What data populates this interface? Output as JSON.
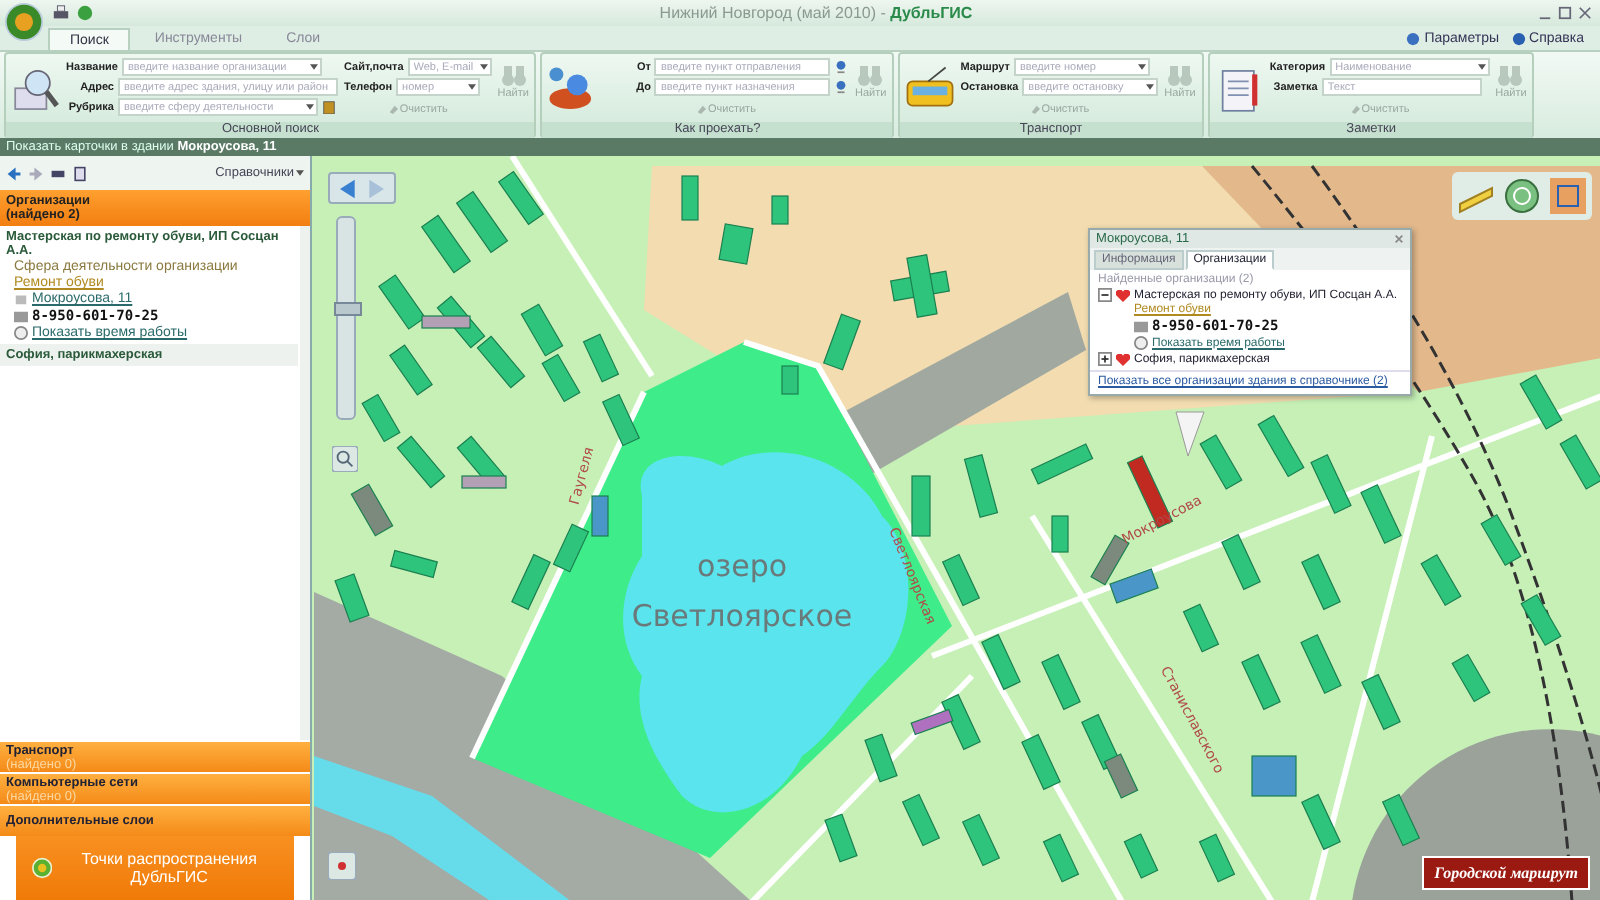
{
  "window": {
    "title": "Нижний Новгород (май 2010) - **ДубльГИС**"
  },
  "tabs": [
    {
      "label": "Поиск",
      "selected": true
    },
    {
      "label": "Инструменты",
      "selected": false
    },
    {
      "label": "Слои",
      "selected": false
    }
  ],
  "help_links": [
    "Параметры",
    "Справка"
  ],
  "ribbon": [
    {
      "title": "Основной поиск",
      "kind": "search",
      "columns": [
        [
          {
            "label": "Название",
            "placeholder": "введите название организации",
            "kind": "dropdown"
          },
          {
            "label": "Адрес",
            "placeholder": "введите адрес здания, улицу или район",
            "kind": "text"
          },
          {
            "label": "Рубрика",
            "placeholder": "введите сферу деятельности",
            "kind": "rubric"
          }
        ],
        [
          {
            "label": "Сайт,почта",
            "placeholder": "Web, E-mail",
            "kind": "dropdown"
          },
          {
            "label": "Телефон",
            "placeholder": "номер",
            "kind": "dropdown"
          }
        ]
      ],
      "clear": {
        "label": "Очистить",
        "disabled": true
      },
      "find": {
        "label": "Найти",
        "disabled": true
      }
    },
    {
      "title": "Как проехать?",
      "kind": "route",
      "columns": [
        [
          {
            "label": "От",
            "placeholder": "введите пункт отправления",
            "kind": "route"
          },
          {
            "label": "До",
            "placeholder": "введите пункт назначения",
            "kind": "route"
          }
        ]
      ],
      "clear": {
        "label": "Очистить",
        "disabled": true
      },
      "find": {
        "label": "Найти",
        "disabled": true
      }
    },
    {
      "title": "Транспорт",
      "kind": "bus",
      "columns": [
        [
          {
            "label": "Маршрут",
            "placeholder": "введите номер",
            "kind": "dropdown"
          },
          {
            "label": "Остановка",
            "placeholder": "введите остановку",
            "kind": "dropdown"
          }
        ]
      ],
      "clear": {
        "label": "Очистить",
        "disabled": true
      },
      "find": {
        "label": "Найти",
        "disabled": true
      }
    },
    {
      "title": "Заметки",
      "kind": "notes",
      "columns": [
        [
          {
            "label": "Категория",
            "placeholder": "Наименование",
            "kind": "dropdown"
          },
          {
            "label": "Заметка",
            "placeholder": "Текст",
            "kind": "text"
          }
        ]
      ],
      "clear": {
        "label": "Очистить",
        "disabled": true
      },
      "find": {
        "label": "Найти",
        "disabled": true
      }
    }
  ],
  "hint_bar": "Показать карточки в здании **Мокроусова, 11**",
  "left_panel": {
    "directories_button": "Справочники",
    "organizations": {
      "title": "Организации",
      "count": "(найдено 2)",
      "items": [
        {
          "name": "Мастерская по ремонту обуви, ИП Сосцан А.А.",
          "expanded": true,
          "category_caption": "Сфера деятельности организации",
          "category": "Ремонт обуви",
          "address": "Мокроусова, 11",
          "phone": "8-950-601-70-25",
          "hours_link": "Показать время работы"
        },
        {
          "name": "София, парикмахерская",
          "expanded": false
        }
      ]
    },
    "sections": [
      {
        "title": "Транспорт",
        "count": "(найдено 0)"
      },
      {
        "title": "Компьютерные сети",
        "count": "(найдено 0)"
      },
      {
        "title": "Дополнительные слои"
      }
    ],
    "promo_button": "Точки распространения ДубльГИС"
  },
  "map": {
    "labels": [
      {
        "text": "озеро",
        "kind": "lake"
      },
      {
        "text": "Светлоярское",
        "kind": "lake"
      },
      {
        "text": "Мокроусова",
        "kind": "street"
      },
      {
        "text": "Станиславского",
        "kind": "street"
      },
      {
        "text": "Светлоярская",
        "kind": "street"
      },
      {
        "text": "Гаугеля",
        "kind": "street"
      }
    ],
    "zoom": {
      "level": 0.55
    },
    "route_button": "Городской маршрут",
    "popup": {
      "title": "Мокроусова, 11",
      "tabs": [
        {
          "label": "Информация",
          "selected": false
        },
        {
          "label": "Организации",
          "selected": true
        }
      ],
      "found_caption": "Найденные организации (2)",
      "items": [
        {
          "name": "Мастерская по ремонту обуви, ИП Сосцан А.А.",
          "expanded": true,
          "category": "Ремонт обуви",
          "phone": "8-950-601-70-25",
          "hours_link": "Показать время работы"
        },
        {
          "name": "София, парикмахерская",
          "expanded": false
        }
      ],
      "footer_link": "Показать все организации здания в справочнике (2)"
    }
  }
}
